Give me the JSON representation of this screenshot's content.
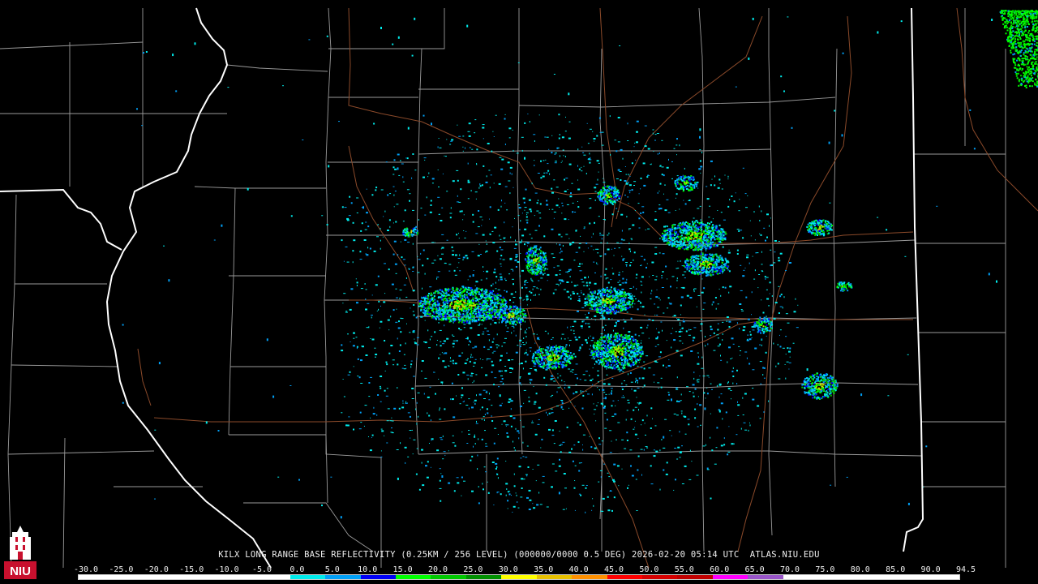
{
  "caption": "KILX LONG RANGE BASE REFLECTIVITY (0.25KM / 256 LEVEL) (000000/0000 0.5 DEG) 2026-02-20 05:14 UTC  ATLAS.NIU.EDU",
  "logo": {
    "text": "NIU",
    "icon": "niu-castle-logo-icon"
  },
  "scale": {
    "labels": [
      "-30.0",
      "-25.0",
      "-20.0",
      "-15.0",
      "-10.0",
      "-5.0",
      "0.0",
      "5.0",
      "10.0",
      "15.0",
      "20.0",
      "25.0",
      "30.0",
      "35.0",
      "40.0",
      "45.0",
      "50.0",
      "55.0",
      "60.0",
      "65.0",
      "70.0",
      "75.0",
      "80.0",
      "85.0",
      "90.0",
      "94.5"
    ],
    "colors": [
      "#ffffff",
      "#ffffff",
      "#ffffff",
      "#ffffff",
      "#ffffff",
      "#ffffff",
      "#00ecec",
      "#01a0f6",
      "#0000f6",
      "#00ff00",
      "#00c800",
      "#009000",
      "#ffff00",
      "#e7c000",
      "#ff9000",
      "#ff0000",
      "#d60000",
      "#c00000",
      "#ff00ff",
      "#9955c9",
      "#ffffff",
      "#ffffff",
      "#ffffff",
      "#ffffff",
      "#ffffff"
    ]
  },
  "colors": {
    "state_borders": "#ffffff",
    "county_borders": "#9a9a9a",
    "highways": "#8b4a2a",
    "background": "#000000"
  }
}
